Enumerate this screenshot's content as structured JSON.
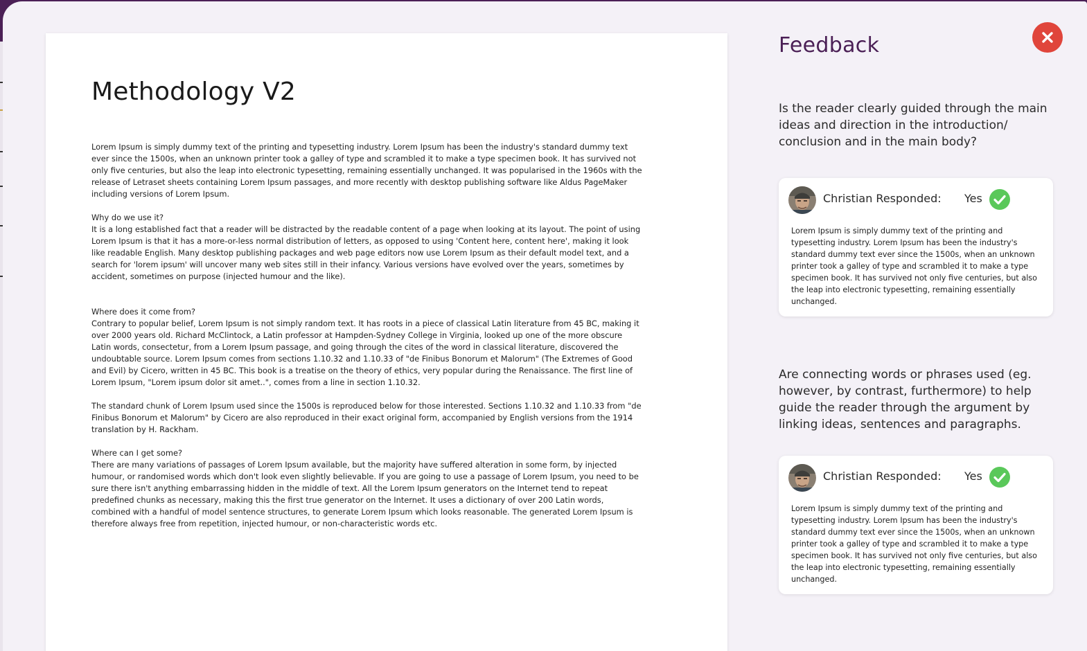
{
  "document": {
    "title": "Methodology V2",
    "paragraphs": [
      "Lorem Ipsum is simply dummy text of the printing and typesetting industry. Lorem Ipsum has been the industry's standard dummy text ever since the 1500s, when an unknown printer took a galley of type and scrambled it to make a type specimen book. It has survived not only five centuries, but also the leap into electronic typesetting, remaining essentially unchanged. It was popularised in the 1960s with the release of Letraset sheets containing Lorem Ipsum passages, and more recently with desktop publishing software like Aldus PageMaker including versions of Lorem Ipsum.",
      "Why do we use it?",
      "It is a long established fact that a reader will be distracted by the readable content of a page when looking at its layout. The point of using Lorem Ipsum is that it has a more-or-less normal distribution of letters, as opposed to using 'Content here, content here', making it look like readable English. Many desktop publishing packages and web page editors now use Lorem Ipsum as their default model text, and a search for 'lorem ipsum' will uncover many web sites still in their infancy. Various versions have evolved over the years, sometimes by accident, sometimes on purpose (injected humour and the like).",
      "Where does it come from?",
      "Contrary to popular belief, Lorem Ipsum is not simply random text. It has roots in a piece of classical Latin literature from 45 BC, making it over 2000 years old. Richard McClintock, a Latin professor at Hampden-Sydney College in Virginia, looked up one of the more obscure Latin words, consectetur, from a Lorem Ipsum passage, and going through the cites of the word in classical literature, discovered the undoubtable source. Lorem Ipsum comes from sections 1.10.32 and 1.10.33 of \"de Finibus Bonorum et Malorum\" (The Extremes of Good and Evil) by Cicero, written in 45 BC. This book is a treatise on the theory of ethics, very popular during the Renaissance. The first line of Lorem Ipsum, \"Lorem ipsum dolor sit amet..\", comes from a line in section 1.10.32.",
      "The standard chunk of Lorem Ipsum used since the 1500s is reproduced below for those interested. Sections 1.10.32 and 1.10.33 from \"de Finibus Bonorum et Malorum\" by Cicero are also reproduced in their exact original form, accompanied by English versions from the 1914 translation by H. Rackham.",
      "Where can I get some?",
      "There are many variations of passages of Lorem Ipsum available, but the majority have suffered alteration in some form, by injected humour, or randomised words which don't look even slightly believable. If you are going to use a passage of Lorem Ipsum, you need to be sure there isn't anything embarrassing hidden in the middle of text. All the Lorem Ipsum generators on the Internet tend to repeat predefined chunks as necessary, making this the first true generator on the Internet. It uses a dictionary of over 200 Latin words, combined with a handful of model sentence structures, to generate Lorem Ipsum which looks reasonable. The generated Lorem Ipsum is therefore always free from repetition, injected humour, or non-characteristic words etc."
    ]
  },
  "feedback": {
    "title": "Feedback",
    "close_icon": "close-icon",
    "items": [
      {
        "question": "Is the reader clearly guided through the main ideas and direction in the introduction/ conclusion and in the main body?",
        "responder": "Christian Responded:",
        "answer": "Yes",
        "answer_icon": "check-circle-icon",
        "response": "Lorem Ipsum is simply dummy text of the printing and typesetting industry. Lorem Ipsum has been the industry's standard dummy text ever since the 1500s, when an unknown printer took a galley of type and scrambled it to make a type specimen book. It has survived not only five centuries, but also the leap into electronic typesetting, remaining essentially unchanged."
      },
      {
        "question": "Are connecting words or phrases used (eg. however, by contrast, furthermore) to help guide the reader through the argument by linking ideas, sentences and paragraphs.",
        "responder": "Christian Responded:",
        "answer": "Yes",
        "answer_icon": "check-circle-icon",
        "response": "Lorem Ipsum is simply dummy text of the printing and typesetting industry. Lorem Ipsum has been the industry's standard dummy text ever since the 1500s, when an unknown printer took a galley of type and scrambled it to make a type specimen book. It has survived not only five centuries, but also the leap into electronic typesetting, remaining essentially unchanged."
      }
    ]
  },
  "colors": {
    "brand_purple": "#4b2056",
    "close_red": "#e0453b",
    "check_green": "#5ac85a",
    "panel_bg": "#f4f1f7"
  }
}
